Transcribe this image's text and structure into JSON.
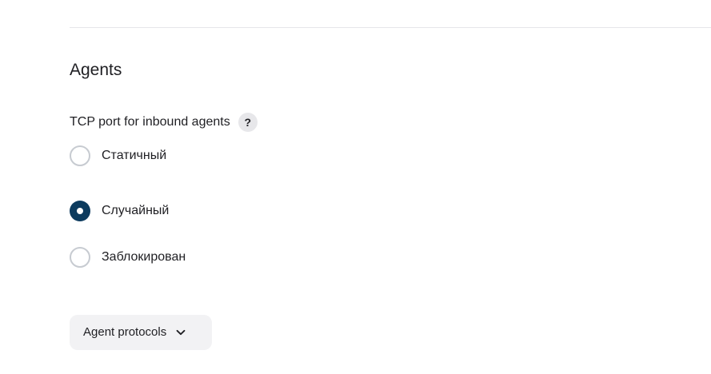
{
  "section": {
    "title": "Agents"
  },
  "tcp_port": {
    "label": "TCP port for inbound agents",
    "help_text": "?",
    "options": [
      {
        "label": "Статичный",
        "checked": false
      },
      {
        "label": "Случайный",
        "checked": true
      },
      {
        "label": "Заблокирован",
        "checked": false
      }
    ]
  },
  "advanced": {
    "button_label": "Agent protocols",
    "icon": "chevron-down-icon"
  },
  "colors": {
    "accent": "#0d3b5e",
    "radio_border": "#c7cbd1",
    "button_bg": "#f2f2f4",
    "help_bg": "#e7e7ea",
    "divider": "#e6e6ea"
  }
}
